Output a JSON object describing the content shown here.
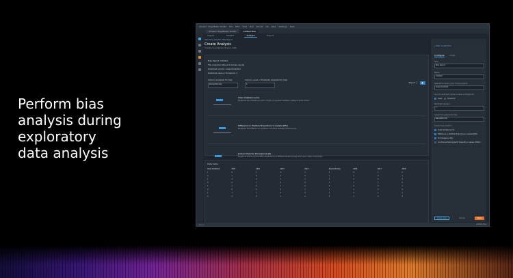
{
  "slide": {
    "caption_lines": [
      "Perform bias",
      "analysis during",
      "exploratory",
      "data analysis"
    ]
  },
  "window": {
    "title": "Amazon SageMaker Studio",
    "menu": [
      "File",
      "Edit",
      "View",
      "Run",
      "Kernel",
      "Git",
      "Tabs",
      "Settings",
      "Help"
    ],
    "file_tabs": [
      {
        "label": "Amazon SageMaker Studio"
      },
      {
        "label": "untitled.flow"
      }
    ],
    "sub_tabs": [
      "Import",
      "Prepare",
      "Analyze",
      "Export"
    ],
    "status_left": "0 ⓢ 1",
    "status_right": "untitled.flow"
  },
  "main": {
    "breadcrumb": "Data flow / Prepare / Bias Report",
    "title": "Create Analysis",
    "description": "Create an analysis of your data",
    "report_lines": [
      "Bias Report: Untitled",
      "The analyzed data and its bias results",
      "Predicted column: Class Predicted",
      "Predicted value or threshold: 1"
    ],
    "select_a_label": "Column analyzed for bias",
    "select_a_value": "Race/ethnicity",
    "select_b_label": "Column value or threshold analyzed for bias",
    "select_b_value": "1",
    "report_button": "Report ⓘ",
    "metrics": [
      {
        "name": "Class Imbalance (CI)",
        "desc": "Measures the imbalance in the number of members between different facet values."
      },
      {
        "name": "Difference in Positive Proportions in Labels (DPL)",
        "desc": "Measures the difference in positive outcomes between facet groups."
      },
      {
        "name": "Jensen-Shannon Divergence (JS)",
        "desc": "Measures how much the label distributions of different facets diverge from each other entropically."
      }
    ],
    "table_title": "Data table",
    "table_headers": [
      "Class Predicted",
      "Attr1",
      "Attr2",
      "Attr3",
      "Attr4",
      "Race/ethnicity",
      "Attr6",
      "Attr7",
      "Attr8"
    ],
    "table_rows": [
      [
        "1",
        "0",
        "1",
        "0",
        "1",
        "2",
        "0",
        "1",
        "0"
      ],
      [
        "0",
        "1",
        "0",
        "0",
        "0",
        "1",
        "1",
        "0",
        "1"
      ],
      [
        "1",
        "0",
        "0",
        "1",
        "1",
        "3",
        "0",
        "0",
        "0"
      ],
      [
        "0",
        "0",
        "1",
        "0",
        "0",
        "1",
        "1",
        "1",
        "0"
      ],
      [
        "1",
        "1",
        "0",
        "1",
        "0",
        "2",
        "0",
        "0",
        "1"
      ],
      [
        "0",
        "0",
        "0",
        "0",
        "1",
        "1",
        "1",
        "0",
        "0"
      ],
      [
        "1",
        "1",
        "1",
        "0",
        "0",
        "3",
        "0",
        "1",
        "1"
      ],
      [
        "0",
        "0",
        "0",
        "1",
        "1",
        "2",
        "1",
        "0",
        "0"
      ]
    ]
  },
  "right_panel": {
    "back_link": "← Back to data flow",
    "tabs": [
      "Configure",
      "Code"
    ],
    "type_label": "Type",
    "type_value": "Bias Report",
    "name_label": "Name",
    "name_value": "Untitled",
    "predict_label": "Select the column your model predicts",
    "predict_value": "Class Predicted",
    "predicted_type_label": "Is your predicted column a value or threshold?",
    "value_option": "Value",
    "threshold_option": "Threshold",
    "predicted_value_label": "Predicted value(s)",
    "predicted_value": "1",
    "analyze_label": "Column to analyze for bias",
    "analyze_value": "Race/ethnicity",
    "metrics_label": "Choose bias metrics",
    "metric_options": [
      "Class Imbalance (CI)",
      "Difference in Positive Proportions in Labels (DPL)",
      "KL divergence (KL)",
      "Conditional Demographic Disparity in Labels (CDDL)"
    ],
    "cancel": "Cancel",
    "check_bias": "Check bias",
    "save": "Save"
  },
  "colors": {
    "accent_blue": "#2d7fc1",
    "accent_orange": "#e8722c",
    "window_bg": "#1f262e"
  }
}
